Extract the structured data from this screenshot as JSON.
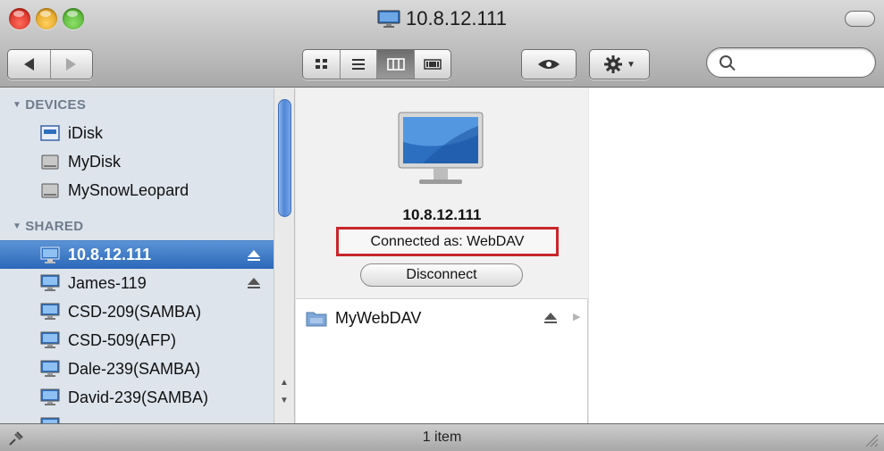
{
  "window": {
    "title": "10.8.12.111"
  },
  "toolbar": {
    "back_icon": "back-arrow-icon",
    "forward_icon": "forward-arrow-icon",
    "view_modes": [
      "icon-view-icon",
      "list-view-icon",
      "column-view-icon",
      "coverflow-view-icon"
    ],
    "active_view": "column-view-icon",
    "quicklook_icon": "eye-icon",
    "action_icon": "gear-icon",
    "search": {
      "value": "",
      "placeholder": ""
    }
  },
  "sidebar": {
    "devices_header": "DEVICES",
    "devices": [
      {
        "label": "iDisk",
        "icon": "idisk-icon"
      },
      {
        "label": "MyDisk",
        "icon": "hard-disk-icon"
      },
      {
        "label": "MySnowLeopard",
        "icon": "hard-disk-icon"
      }
    ],
    "shared_header": "SHARED",
    "shared": [
      {
        "label": "10.8.12.111",
        "icon": "monitor-icon",
        "selected": true,
        "eject": true
      },
      {
        "label": "James-119",
        "icon": "monitor-icon",
        "selected": false,
        "eject": true
      },
      {
        "label": "CSD-209(SAMBA)",
        "icon": "monitor-icon",
        "selected": false,
        "eject": false
      },
      {
        "label": "CSD-509(AFP)",
        "icon": "monitor-icon",
        "selected": false,
        "eject": false
      },
      {
        "label": "Dale-239(SAMBA)",
        "icon": "monitor-icon",
        "selected": false,
        "eject": false
      },
      {
        "label": "David-239(SAMBA)",
        "icon": "monitor-icon",
        "selected": false,
        "eject": false
      }
    ]
  },
  "preview": {
    "name": "10.8.12.111",
    "connected_as": "Connected as: WebDAV",
    "disconnect_label": "Disconnect"
  },
  "column": {
    "items": [
      {
        "label": "MyWebDAV",
        "icon": "shared-folder-icon"
      }
    ]
  },
  "status": {
    "text": "1 item"
  },
  "colors": {
    "selection": "#2b68b9",
    "highlight_box": "#c8262b",
    "sidebar_bg": "#dde4ec"
  }
}
